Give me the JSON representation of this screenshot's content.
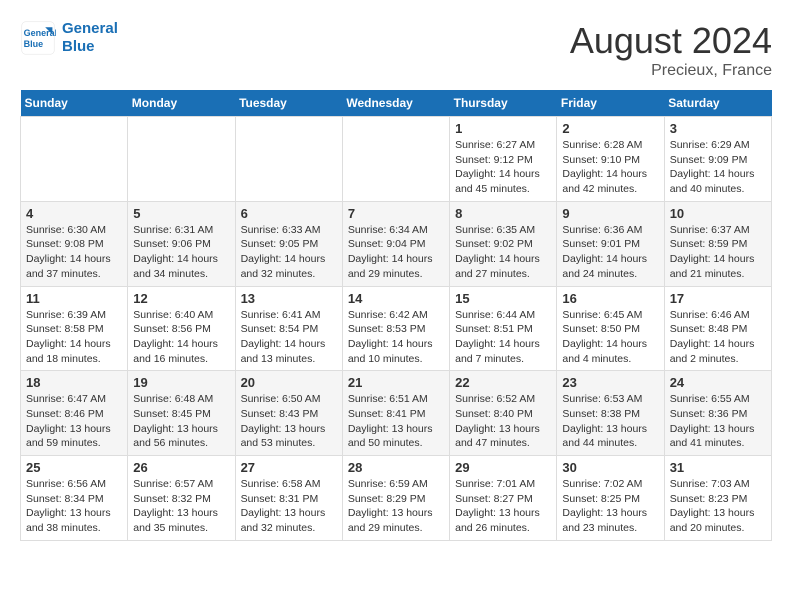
{
  "logo": {
    "line1": "General",
    "line2": "Blue"
  },
  "title": "August 2024",
  "subtitle": "Precieux, France",
  "days_header": [
    "Sunday",
    "Monday",
    "Tuesday",
    "Wednesday",
    "Thursday",
    "Friday",
    "Saturday"
  ],
  "weeks": [
    [
      {
        "day": "",
        "info": ""
      },
      {
        "day": "",
        "info": ""
      },
      {
        "day": "",
        "info": ""
      },
      {
        "day": "",
        "info": ""
      },
      {
        "day": "1",
        "info": "Sunrise: 6:27 AM\nSunset: 9:12 PM\nDaylight: 14 hours and 45 minutes."
      },
      {
        "day": "2",
        "info": "Sunrise: 6:28 AM\nSunset: 9:10 PM\nDaylight: 14 hours and 42 minutes."
      },
      {
        "day": "3",
        "info": "Sunrise: 6:29 AM\nSunset: 9:09 PM\nDaylight: 14 hours and 40 minutes."
      }
    ],
    [
      {
        "day": "4",
        "info": "Sunrise: 6:30 AM\nSunset: 9:08 PM\nDaylight: 14 hours and 37 minutes."
      },
      {
        "day": "5",
        "info": "Sunrise: 6:31 AM\nSunset: 9:06 PM\nDaylight: 14 hours and 34 minutes."
      },
      {
        "day": "6",
        "info": "Sunrise: 6:33 AM\nSunset: 9:05 PM\nDaylight: 14 hours and 32 minutes."
      },
      {
        "day": "7",
        "info": "Sunrise: 6:34 AM\nSunset: 9:04 PM\nDaylight: 14 hours and 29 minutes."
      },
      {
        "day": "8",
        "info": "Sunrise: 6:35 AM\nSunset: 9:02 PM\nDaylight: 14 hours and 27 minutes."
      },
      {
        "day": "9",
        "info": "Sunrise: 6:36 AM\nSunset: 9:01 PM\nDaylight: 14 hours and 24 minutes."
      },
      {
        "day": "10",
        "info": "Sunrise: 6:37 AM\nSunset: 8:59 PM\nDaylight: 14 hours and 21 minutes."
      }
    ],
    [
      {
        "day": "11",
        "info": "Sunrise: 6:39 AM\nSunset: 8:58 PM\nDaylight: 14 hours and 18 minutes."
      },
      {
        "day": "12",
        "info": "Sunrise: 6:40 AM\nSunset: 8:56 PM\nDaylight: 14 hours and 16 minutes."
      },
      {
        "day": "13",
        "info": "Sunrise: 6:41 AM\nSunset: 8:54 PM\nDaylight: 14 hours and 13 minutes."
      },
      {
        "day": "14",
        "info": "Sunrise: 6:42 AM\nSunset: 8:53 PM\nDaylight: 14 hours and 10 minutes."
      },
      {
        "day": "15",
        "info": "Sunrise: 6:44 AM\nSunset: 8:51 PM\nDaylight: 14 hours and 7 minutes."
      },
      {
        "day": "16",
        "info": "Sunrise: 6:45 AM\nSunset: 8:50 PM\nDaylight: 14 hours and 4 minutes."
      },
      {
        "day": "17",
        "info": "Sunrise: 6:46 AM\nSunset: 8:48 PM\nDaylight: 14 hours and 2 minutes."
      }
    ],
    [
      {
        "day": "18",
        "info": "Sunrise: 6:47 AM\nSunset: 8:46 PM\nDaylight: 13 hours and 59 minutes."
      },
      {
        "day": "19",
        "info": "Sunrise: 6:48 AM\nSunset: 8:45 PM\nDaylight: 13 hours and 56 minutes."
      },
      {
        "day": "20",
        "info": "Sunrise: 6:50 AM\nSunset: 8:43 PM\nDaylight: 13 hours and 53 minutes."
      },
      {
        "day": "21",
        "info": "Sunrise: 6:51 AM\nSunset: 8:41 PM\nDaylight: 13 hours and 50 minutes."
      },
      {
        "day": "22",
        "info": "Sunrise: 6:52 AM\nSunset: 8:40 PM\nDaylight: 13 hours and 47 minutes."
      },
      {
        "day": "23",
        "info": "Sunrise: 6:53 AM\nSunset: 8:38 PM\nDaylight: 13 hours and 44 minutes."
      },
      {
        "day": "24",
        "info": "Sunrise: 6:55 AM\nSunset: 8:36 PM\nDaylight: 13 hours and 41 minutes."
      }
    ],
    [
      {
        "day": "25",
        "info": "Sunrise: 6:56 AM\nSunset: 8:34 PM\nDaylight: 13 hours and 38 minutes."
      },
      {
        "day": "26",
        "info": "Sunrise: 6:57 AM\nSunset: 8:32 PM\nDaylight: 13 hours and 35 minutes."
      },
      {
        "day": "27",
        "info": "Sunrise: 6:58 AM\nSunset: 8:31 PM\nDaylight: 13 hours and 32 minutes."
      },
      {
        "day": "28",
        "info": "Sunrise: 6:59 AM\nSunset: 8:29 PM\nDaylight: 13 hours and 29 minutes."
      },
      {
        "day": "29",
        "info": "Sunrise: 7:01 AM\nSunset: 8:27 PM\nDaylight: 13 hours and 26 minutes."
      },
      {
        "day": "30",
        "info": "Sunrise: 7:02 AM\nSunset: 8:25 PM\nDaylight: 13 hours and 23 minutes."
      },
      {
        "day": "31",
        "info": "Sunrise: 7:03 AM\nSunset: 8:23 PM\nDaylight: 13 hours and 20 minutes."
      }
    ]
  ]
}
